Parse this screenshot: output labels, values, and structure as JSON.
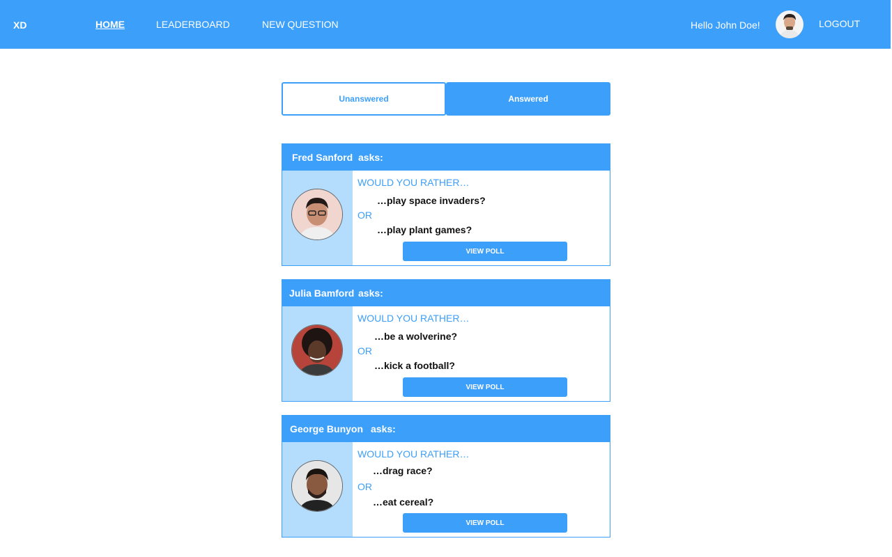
{
  "nav": {
    "brand": "XD",
    "home": "HOME",
    "leaderboard": "LEADERBOARD",
    "new_question": "NEW QUESTION",
    "greeting": "Hello John Doe!",
    "logout": "LOGOUT"
  },
  "tabs": {
    "unanswered": "Unanswered",
    "answered": "Answered",
    "active": "Answered"
  },
  "polls": [
    {
      "author": "Fred Sanford",
      "asks": "asks:",
      "prompt": "WOULD YOU RATHER…",
      "option_one": "…play space invaders?",
      "or": "OR",
      "option_two": "…play plant games?",
      "button": "VIEW POLL"
    },
    {
      "author": "Julia Bamford",
      "asks": "asks:",
      "prompt": "WOULD YOU RATHER…",
      "option_one": "…be a wolverine?",
      "or": "OR",
      "option_two": "…kick a football?",
      "button": "VIEW POLL"
    },
    {
      "author": "George Bunyon",
      "asks": "asks:",
      "prompt": "WOULD YOU RATHER…",
      "option_one": "…drag race?",
      "or": "OR",
      "option_two": "…eat cereal?",
      "button": "VIEW POLL"
    }
  ],
  "colors": {
    "primary": "#3c9ffa",
    "sidebar": "#b3dcfd"
  }
}
